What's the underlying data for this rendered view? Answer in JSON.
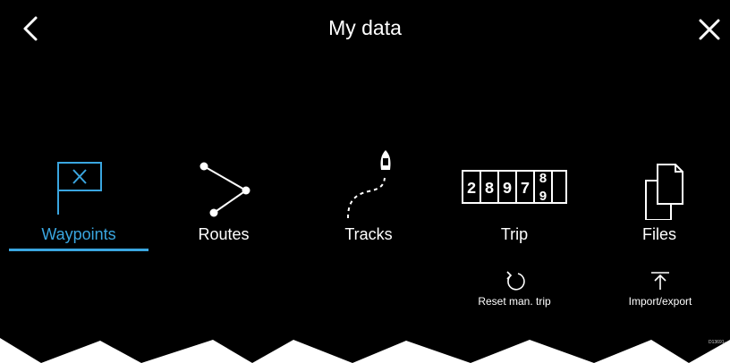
{
  "header": {
    "title": "My data",
    "back_icon": "chevron-left-icon",
    "close_icon": "close-icon"
  },
  "tabs": [
    {
      "label": "Waypoints",
      "icon": "waypoint-flag-icon",
      "active": true
    },
    {
      "label": "Routes",
      "icon": "route-icon",
      "active": false
    },
    {
      "label": "Tracks",
      "icon": "track-boat-icon",
      "active": false
    },
    {
      "label": "Trip",
      "icon": "trip-counter-icon",
      "active": false,
      "counter_digits": [
        "2",
        "8",
        "9",
        "7"
      ],
      "counter_roll": [
        "8",
        "9"
      ]
    },
    {
      "label": "Files",
      "icon": "files-icon",
      "active": false
    }
  ],
  "actions": [
    {
      "label": "Reset man. trip",
      "icon": "reset-icon"
    },
    {
      "label": "Import/export",
      "icon": "import-export-icon"
    }
  ],
  "footer_code": "D13691-",
  "colors": {
    "accent": "#3aa6e0",
    "background": "#000000",
    "text": "#ffffff"
  }
}
